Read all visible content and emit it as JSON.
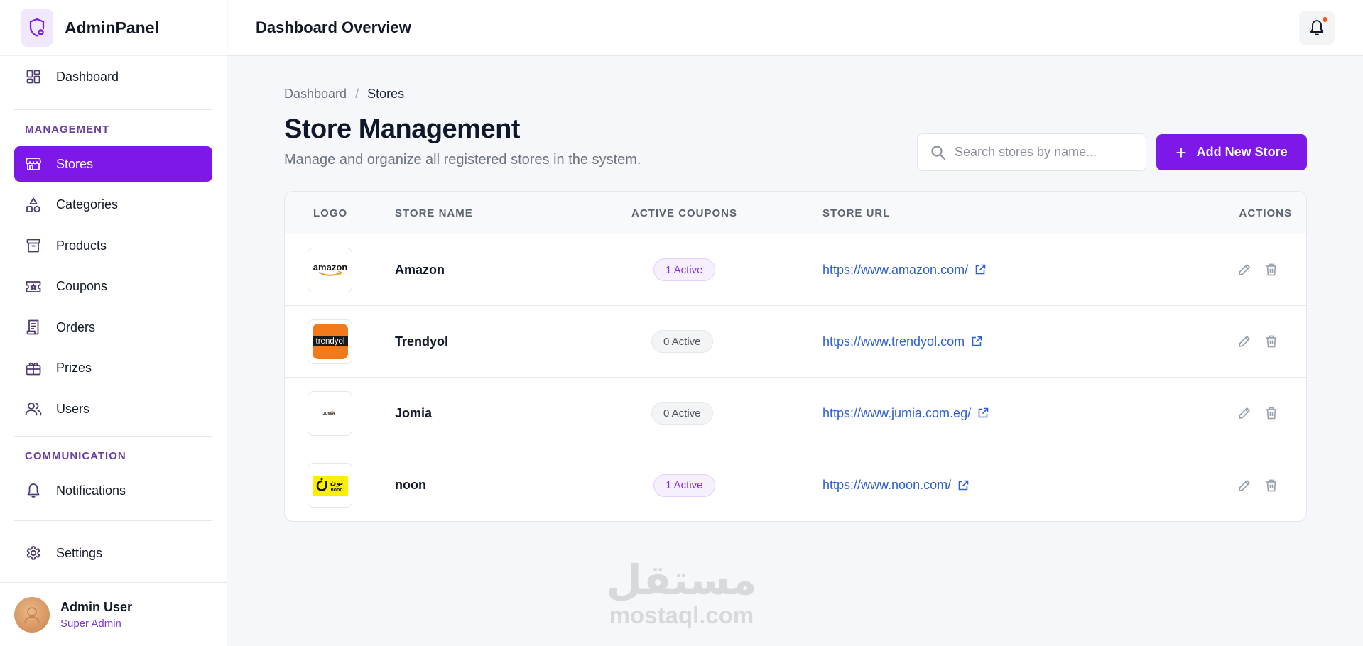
{
  "app": {
    "name": "AdminPanel"
  },
  "header": {
    "title": "Dashboard Overview",
    "notification_icon": "bell-icon",
    "notification_dot_color": "#f05a1a"
  },
  "sidebar": {
    "dashboard": {
      "label": "Dashboard",
      "icon": "dashboard-grid-icon"
    },
    "section_management": "MANAGEMENT",
    "items": [
      {
        "label": "Stores",
        "icon": "store-icon",
        "active": true
      },
      {
        "label": "Categories",
        "icon": "shapes-icon"
      },
      {
        "label": "Products",
        "icon": "archive-box-icon"
      },
      {
        "label": "Coupons",
        "icon": "ticket-icon"
      },
      {
        "label": "Orders",
        "icon": "receipt-icon"
      },
      {
        "label": "Prizes",
        "icon": "gift-icon"
      },
      {
        "label": "Users",
        "icon": "users-icon"
      }
    ],
    "section_communication": "COMMUNICATION",
    "notifications": {
      "label": "Notifications",
      "icon": "bell-icon"
    },
    "settings": {
      "label": "Settings",
      "icon": "gear-icon"
    },
    "user": {
      "name": "Admin User",
      "role": "Super Admin"
    }
  },
  "breadcrumb": {
    "root": "Dashboard",
    "separator": "/",
    "current": "Stores"
  },
  "page": {
    "title": "Store Management",
    "subtitle": "Manage and organize all registered stores in the system."
  },
  "search": {
    "placeholder": "Search stores by name...",
    "value": ""
  },
  "add_button": {
    "label": "Add New Store"
  },
  "table": {
    "columns": [
      "LOGO",
      "STORE NAME",
      "ACTIVE COUPONS",
      "STORE URL",
      "ACTIONS"
    ],
    "rows": [
      {
        "logo": "amazon",
        "name": "Amazon",
        "coupons": "1 Active",
        "coupons_active": true,
        "url": "https://www.amazon.com/"
      },
      {
        "logo": "trendyol",
        "name": "Trendyol",
        "coupons": "0 Active",
        "coupons_active": false,
        "url": "https://www.trendyol.com"
      },
      {
        "logo": "JUMIA",
        "name": "Jomia",
        "coupons": "0 Active",
        "coupons_active": false,
        "url": "https://www.jumia.com.eg/"
      },
      {
        "logo": "noon",
        "name": "noon",
        "coupons": "1 Active",
        "coupons_active": true,
        "url": "https://www.noon.com/"
      }
    ]
  },
  "watermark": {
    "arabic": "مستقل",
    "latin": "mostaql.com"
  },
  "colors": {
    "accent": "#7e18e8",
    "link": "#2f5fd7",
    "section_label": "#6b3fa0"
  }
}
